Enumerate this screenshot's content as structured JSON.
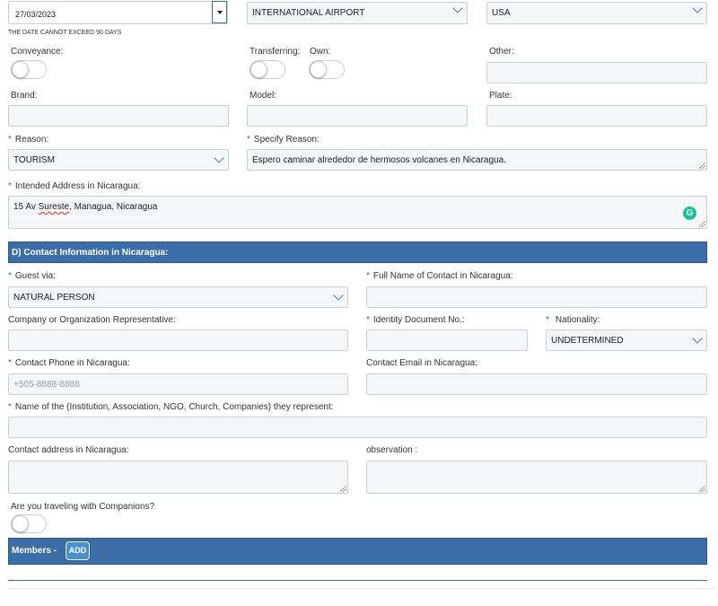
{
  "top_row": {
    "date_value": "27/03/2023",
    "date_hint": "THE DATE CANNOT EXCEED 90 DAYS",
    "entry_point_value": "INTERNATIONAL AIRPORT",
    "country_value": "USA"
  },
  "conveyance": {
    "conveyance_label": "Conveyance:",
    "transferring_label": "Transferring:",
    "own_label": "Own:",
    "other_label": "Other:",
    "brand_label": "Brand:",
    "model_label": "Model:",
    "plate_label": "Plate:"
  },
  "reason": {
    "required_mark": "*",
    "reason_label": "Reason:",
    "reason_value": "TOURISM",
    "specify_label": "Specify Reason:",
    "specify_value": "Espero caminar alrededor de hermosos volcanes en Nicaragua.",
    "address_label": "Intended Address in Nicaragua:",
    "address_value_pre": "15 Av ",
    "address_value_err": "Sureste",
    "address_value_post": ", Managua, Nicaragua",
    "grammarly_glyph": "G"
  },
  "contact": {
    "section_title": "D) Contact Information in Nicaragua:",
    "guest_via_label": "Guest via:",
    "guest_via_value": "NATURAL PERSON",
    "full_name_label": "Full Name of Contact in Nicaragua:",
    "company_label": "Company or Organization Representative:",
    "identity_label": "Identity Document No.:",
    "nationality_label": "Nationality:",
    "nationality_value": "UNDETERMINED",
    "phone_label": "Contact Phone in Nicaragua:",
    "phone_placeholder": "+505-8888-8888",
    "email_label": "Contact Email in Nicaragua:",
    "institution_label": "Name of the (Institution, Association, NGO, Church, Companies) they represent:",
    "address_label": "Contact address in Nicaragua:",
    "observation_label": "observation :",
    "companions_label": "Are you traveling with Companions?"
  },
  "members": {
    "title": "Members -",
    "add_label": "ADD"
  },
  "colors": {
    "accent": "#3b6ea8",
    "required": "#3366aa",
    "field_bg": "#f5f6f7"
  }
}
